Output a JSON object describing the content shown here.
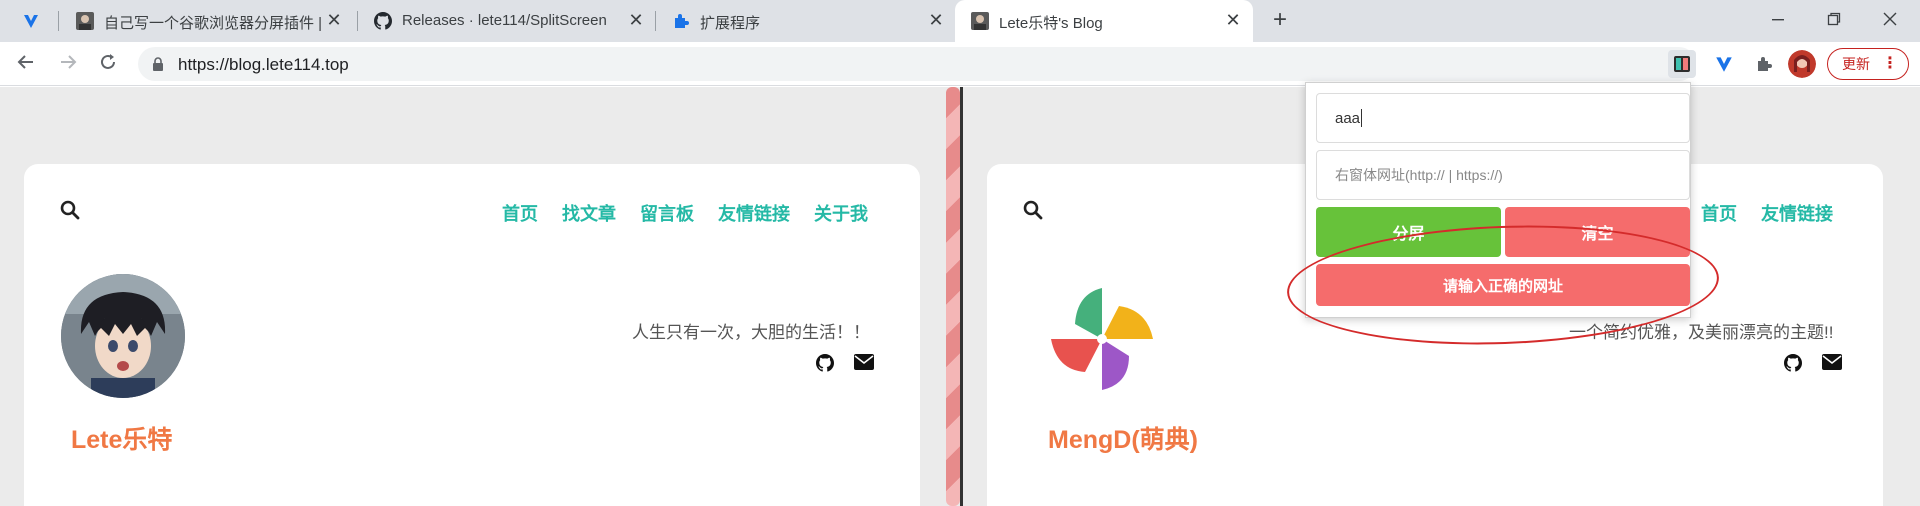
{
  "browser": {
    "tabs": [
      {
        "title": "",
        "icon": "vivaldi-v-icon"
      },
      {
        "title": "自己写一个谷歌浏览器分屏插件 |",
        "icon": "avatar-icon"
      },
      {
        "title": "Releases · lete114/SplitScreen",
        "icon": "github-icon"
      },
      {
        "title": "扩展程序",
        "icon": "puzzle-icon"
      },
      {
        "title": "Lete乐特's Blog",
        "icon": "avatar-icon"
      }
    ],
    "url": "https://blog.lete114.top",
    "update_label": "更新",
    "accent": "#1a73e8"
  },
  "left_page": {
    "nav": [
      "首页",
      "找文章",
      "留言板",
      "友情链接",
      "关于我"
    ],
    "motto": "人生只有一次，大胆的生活！！",
    "name": "Lete乐特"
  },
  "right_page": {
    "nav": [
      "首页",
      "友情链接"
    ],
    "motto": "一个简约优雅，及美丽漂亮的主题!!",
    "name": "MengD(萌典)"
  },
  "popup": {
    "input_value": "aaa",
    "right_url_placeholder": "右窗体网址(http:// | https://)",
    "split_label": "分屏",
    "clear_label": "清空",
    "error_label": "请输入正确的网址",
    "colors": {
      "green": "#67c23a",
      "red": "#f56c6c",
      "annotation": "#d42b2b"
    }
  }
}
